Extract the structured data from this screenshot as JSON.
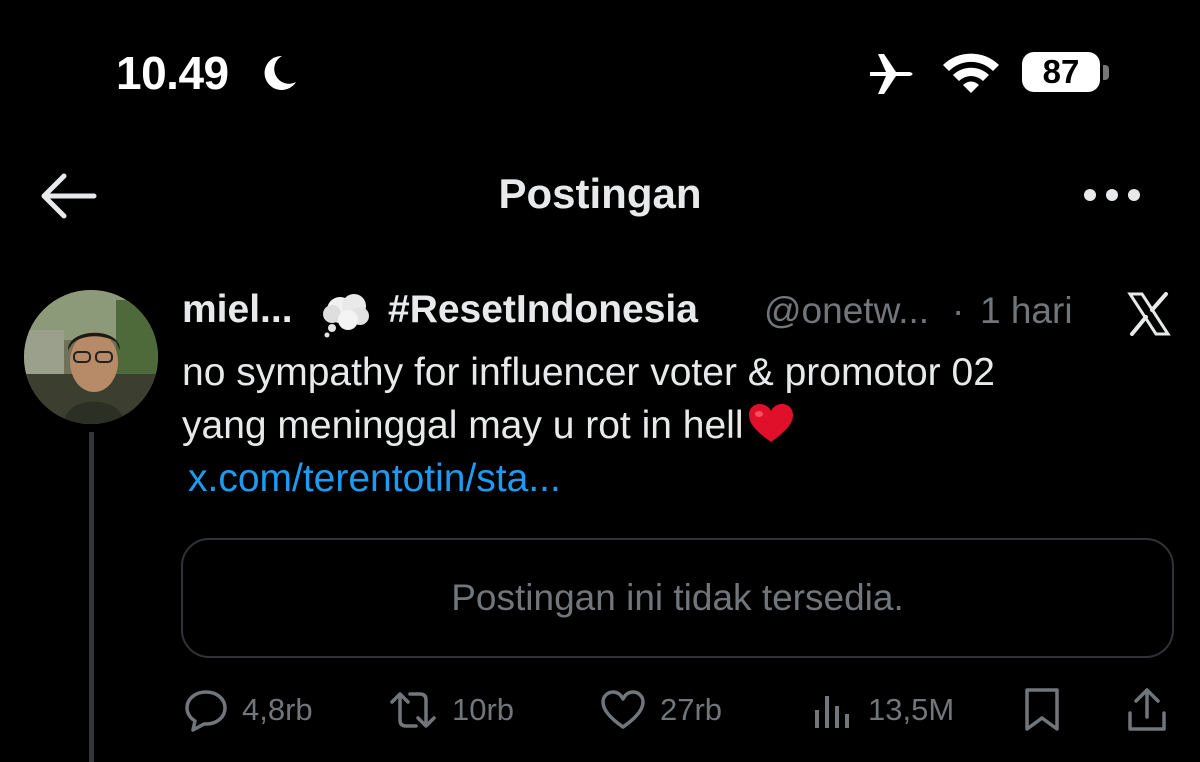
{
  "status_bar": {
    "time": "10.49",
    "battery_level": "87",
    "icons": [
      "moon-icon",
      "airplane-icon",
      "wifi-icon",
      "battery-icon"
    ]
  },
  "header": {
    "title": "Postingan",
    "back_icon": "arrow-left-icon",
    "more_icon": "more-horizontal-icon"
  },
  "post": {
    "author_name": "miel...",
    "author_emoji": "thought-balloon-icon",
    "author_tag": "#ResetIndonesia",
    "handle": "@onetw...",
    "separator": "·",
    "time": "1 hari",
    "source_icon": "x-logo-icon",
    "text_line1": "no sympathy for influencer voter & promotor 02",
    "text_line2": "yang meninggal may u rot in hell",
    "emoji": "red-heart-icon",
    "link": "x.com/terentotin/sta...",
    "quote_unavailable": "Postingan ini tidak tersedia."
  },
  "actions": {
    "replies": "4,8rb",
    "reposts": "10rb",
    "likes": "27rb",
    "views": "13,5M"
  },
  "colors": {
    "background": "#000000",
    "text": "#e7e9ea",
    "secondary": "#71767b",
    "link": "#1d9bf0",
    "border": "#2f3336",
    "heart": "#e0102a"
  }
}
